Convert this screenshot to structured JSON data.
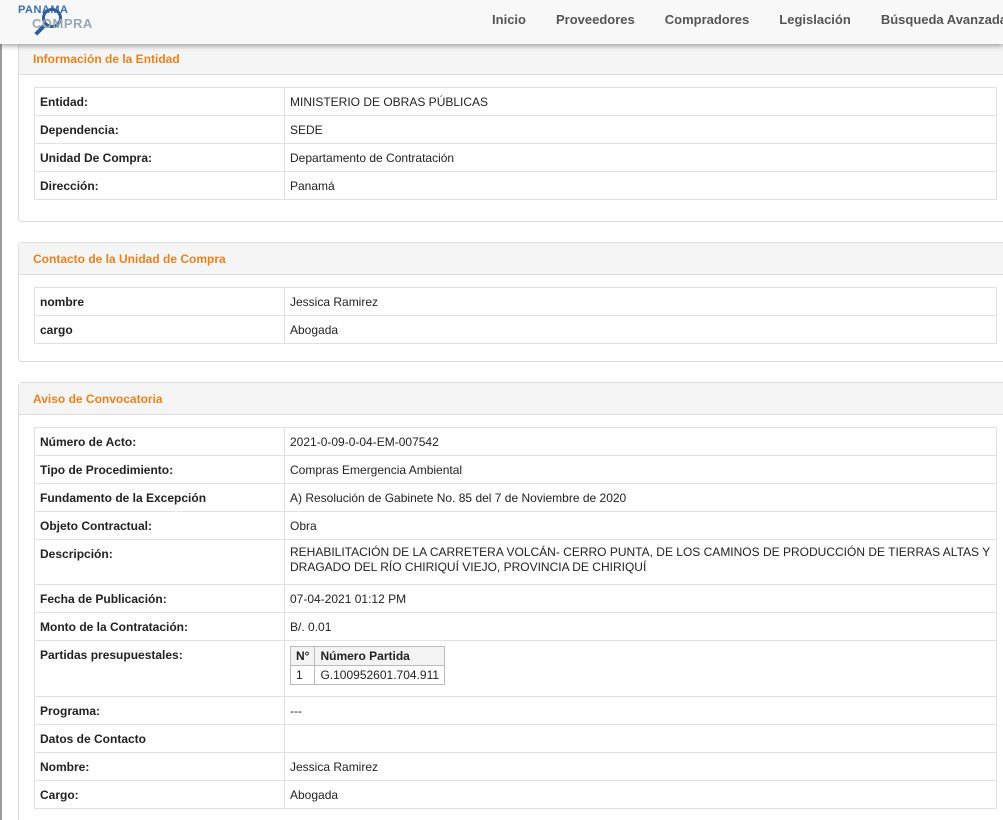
{
  "header": {
    "logo_top": "PANAMA",
    "logo_bottom": "COMPRA",
    "nav": [
      "Inicio",
      "Proveedores",
      "Compradores",
      "Legislación",
      "Búsqueda Avanzada"
    ]
  },
  "entidad": {
    "title": "Información de la Entidad",
    "rows": [
      {
        "label": "Entidad:",
        "value": "MINISTERIO DE OBRAS PÚBLICAS"
      },
      {
        "label": "Dependencia:",
        "value": "SEDE"
      },
      {
        "label": "Unidad De Compra:",
        "value": "Departamento de Contratación"
      },
      {
        "label": "Dirección:",
        "value": "Panamá"
      }
    ]
  },
  "contacto": {
    "title": "Contacto de la Unidad de Compra",
    "rows": [
      {
        "label": "nombre",
        "value": "Jessica Ramirez"
      },
      {
        "label": "cargo",
        "value": "Abogada"
      }
    ]
  },
  "aviso": {
    "title": "Aviso de Convocatoria",
    "rows": [
      {
        "label": "Número de Acto:",
        "value": "2021-0-09-0-04-EM-007542"
      },
      {
        "label": "Tipo de Procedimiento:",
        "value": "Compras Emergencia Ambiental"
      },
      {
        "label": "Fundamento de la Excepción",
        "value": "A) Resolución de Gabinete No. 85 del 7 de Noviembre de 2020"
      },
      {
        "label": "Objeto Contractual:",
        "value": "Obra"
      },
      {
        "label": "Descripción:",
        "value": "REHABILITACIÓN DE LA CARRETERA VOLCÁN- CERRO PUNTA, DE LOS CAMINOS DE PRODUCCIÓN DE TIERRAS ALTAS Y DRAGADO DEL RÍO CHIRIQUÍ VIEJO, PROVINCIA DE CHIRIQUÍ"
      },
      {
        "label": "Fecha de Publicación:",
        "value": "07-04-2021 01:12 PM"
      },
      {
        "label": "Monto de la Contratación:",
        "value": "B/. 0.01"
      },
      {
        "label": "Partidas presupuestales:",
        "value": ""
      },
      {
        "label": "Programa:",
        "value": "---"
      },
      {
        "label": "Datos de Contacto",
        "value": ""
      },
      {
        "label": "Nombre:",
        "value": "Jessica Ramirez"
      },
      {
        "label": "Cargo:",
        "value": "Abogada"
      }
    ],
    "partidas": {
      "headers": [
        "N°",
        "Número Partida"
      ],
      "rows": [
        [
          "1",
          "G.100952601.704.911"
        ]
      ]
    }
  }
}
